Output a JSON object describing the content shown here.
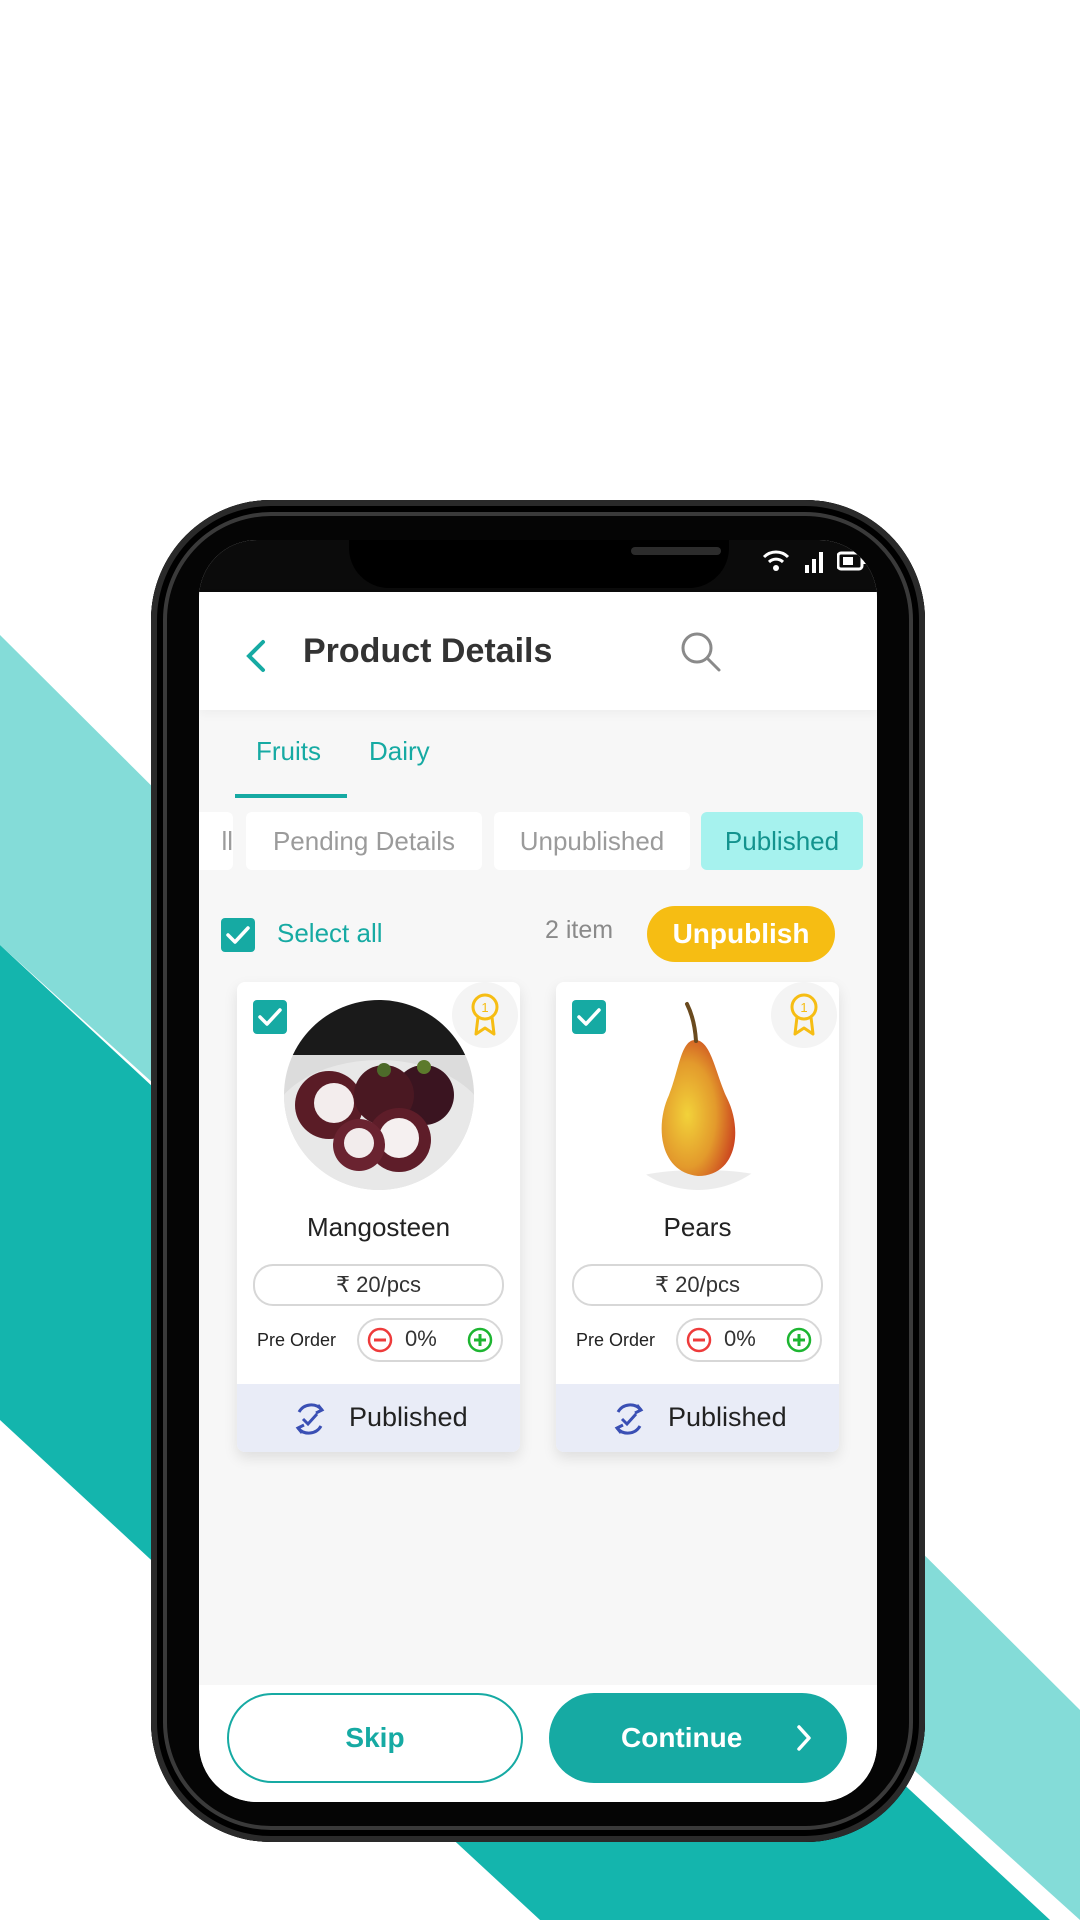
{
  "colors": {
    "accent": "#16aaa3",
    "accent_light": "#84dcd8",
    "highlight": "#f6bd13",
    "published_chip": "#a6f2ee",
    "card_status_bg": "#e9ecf7"
  },
  "header": {
    "title": "Product Details"
  },
  "category_tabs": [
    {
      "label": "Fruits",
      "active": true
    },
    {
      "label": "Dairy",
      "active": false
    }
  ],
  "status_tabs": [
    {
      "label": "ll",
      "active": false
    },
    {
      "label": "Pending Details",
      "active": false
    },
    {
      "label": "Unpublished",
      "active": false
    },
    {
      "label": "Published",
      "active": true
    }
  ],
  "selection": {
    "select_all_label": "Select all",
    "checked": true,
    "count_label": "2 item",
    "action_label": "Unpublish"
  },
  "products": [
    {
      "name": "Mangosteen",
      "price": "₹  20/pcs",
      "preorder_label": "Pre Order",
      "preorder_value": "0%",
      "status": "Published",
      "checked": true,
      "badge_icon": "award-ribbon-icon"
    },
    {
      "name": "Pears",
      "price": "₹  20/pcs",
      "preorder_label": "Pre Order",
      "preorder_value": "0%",
      "status": "Published",
      "checked": true,
      "badge_icon": "award-ribbon-icon"
    }
  ],
  "footer": {
    "skip_label": "Skip",
    "continue_label": "Continue"
  }
}
